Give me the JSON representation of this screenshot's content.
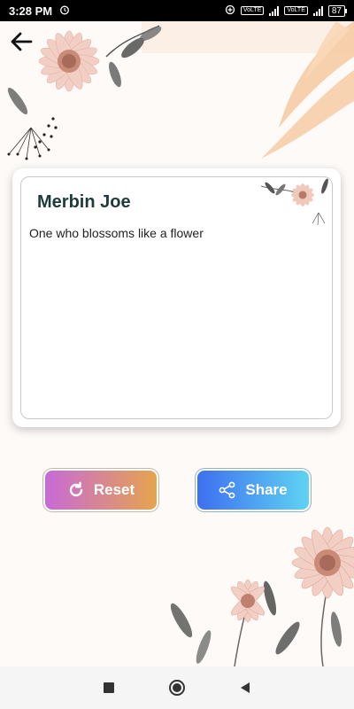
{
  "status_bar": {
    "time": "3:28 PM",
    "battery": "87",
    "network_badge_1": "VoLTE",
    "network_badge_2": "VoLTE"
  },
  "header": {
    "back_icon": "arrow-left-icon"
  },
  "card": {
    "name": "Merbin Joe",
    "meaning": "One who blossoms like a flower"
  },
  "actions": {
    "reset_label": "Reset",
    "reset_icon": "refresh-icon",
    "share_label": "Share",
    "share_icon": "share-icon"
  },
  "nav": {
    "recents_icon": "square-icon",
    "home_icon": "circle-icon",
    "back_icon": "triangle-back-icon"
  },
  "colors": {
    "name_text": "#1d3b3b",
    "reset_gradient": [
      "#c86ad8",
      "#e6a44c"
    ],
    "share_gradient": [
      "#3e6ff0",
      "#5fd3f3"
    ],
    "background": "#fdfaf8"
  }
}
